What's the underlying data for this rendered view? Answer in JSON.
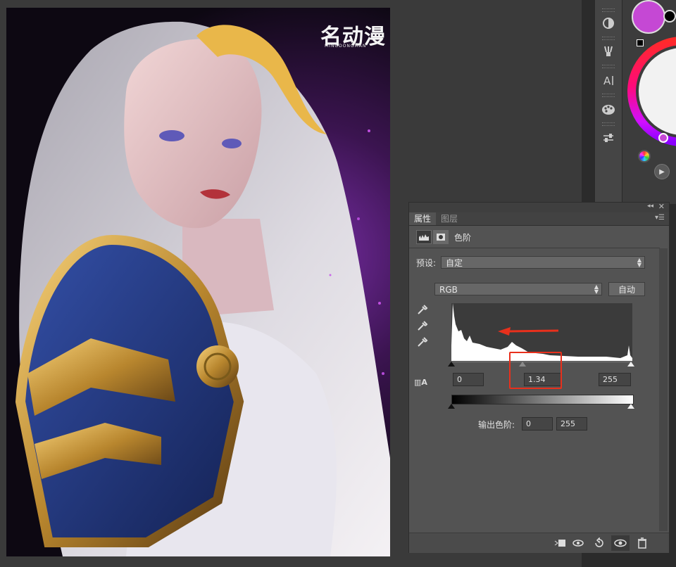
{
  "artwork": {
    "watermark_title": "名动漫",
    "watermark_sub": "MINGDONGMAN"
  },
  "tools": {
    "items": [
      {
        "name": "adjust-icon"
      },
      {
        "name": "brush-icon"
      },
      {
        "name": "text-icon"
      },
      {
        "name": "palette-icon"
      },
      {
        "name": "sliders-icon"
      }
    ]
  },
  "colors": {
    "foreground": "#c548d4",
    "accent_red": "#e8301c"
  },
  "properties_panel": {
    "tabs": [
      {
        "label": "属性",
        "active": true
      },
      {
        "label": "图层",
        "active": false
      }
    ],
    "adjustment_title": "色阶",
    "preset_label": "预设:",
    "preset_value": "自定",
    "channel_value": "RGB",
    "auto_button": "自动",
    "input_black": "0",
    "input_gamma": "1.34",
    "input_white": "255",
    "output_label": "输出色阶:",
    "output_black": "0",
    "output_white": "255"
  }
}
